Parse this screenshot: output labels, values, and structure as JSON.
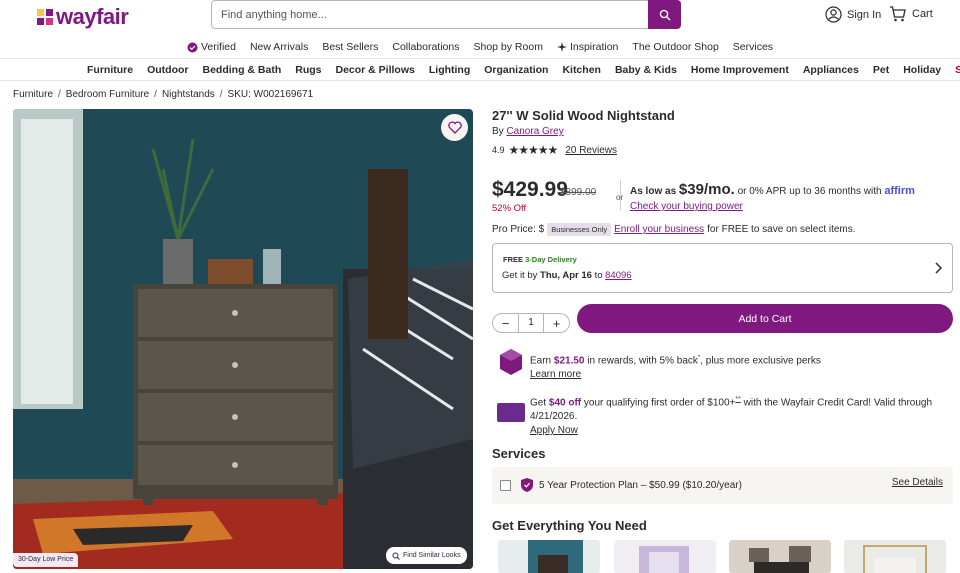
{
  "header": {
    "logo": "wayfair",
    "search_placeholder": "Find anything home...",
    "sign_in": "Sign In",
    "cart": "Cart"
  },
  "nav_primary": [
    "Verified",
    "New Arrivals",
    "Best Sellers",
    "Collaborations",
    "Shop by Room",
    "Inspiration",
    "The Outdoor Shop",
    "Services"
  ],
  "nav_categories": [
    "Furniture",
    "Outdoor",
    "Bedding & Bath",
    "Rugs",
    "Decor & Pillows",
    "Lighting",
    "Organization",
    "Kitchen",
    "Baby & Kids",
    "Home Improvement",
    "Appliances",
    "Pet",
    "Holiday",
    "Sale"
  ],
  "breadcrumb": [
    "Furniture",
    "Bedroom Furniture",
    "Nightstands",
    "SKU: W002169671"
  ],
  "image": {
    "badge": "30-Day Low Price",
    "similar": "Find Similar Looks"
  },
  "product": {
    "title": "27'' W Solid Wood Nightstand",
    "by_prefix": "By",
    "brand": "Canora Grey",
    "rating": "4.9",
    "reviews": "20 Reviews",
    "price": "$429.99",
    "was_price": "$899.00",
    "discount": "52% Off",
    "or": "or",
    "as_low_as": "As low as",
    "monthly": "$39/mo.",
    "apr_text": "or 0% APR up to 36 months with",
    "affirm": "affirm",
    "buying_power": "Check your buying power",
    "pro_price": "Pro Price: $",
    "biz_badge": "Businesses Only",
    "enroll": "Enroll your business",
    "pro_suffix": "for FREE to save on select items."
  },
  "delivery": {
    "tag_free": "FREE",
    "tag_rest": "3-Day Delivery",
    "line_prefix": "Get it by",
    "date": "Thu, Apr 16",
    "line_to": "to",
    "zip": "84096"
  },
  "cart_controls": {
    "qty": "1",
    "add": "Add to Cart"
  },
  "rewards": {
    "earn": "Earn",
    "amount": "$21.50",
    "mid": "in rewards, with 5% back",
    "sup": "*",
    "rest": ", plus more exclusive perks",
    "learn": "Learn more"
  },
  "credit": {
    "get": "Get",
    "amount": "$40 off",
    "mid": "your qualifying first order of $100+",
    "sup": "**",
    "rest": "with the Wayfair Credit Card! Valid through 4/21/2026.",
    "apply": "Apply Now"
  },
  "services": {
    "heading": "Services",
    "plan": "5 Year Protection Plan – $50.99",
    "plan_rate": "($10.20/year)",
    "details": "See Details"
  },
  "everything": {
    "heading": "Get Everything You Need"
  }
}
